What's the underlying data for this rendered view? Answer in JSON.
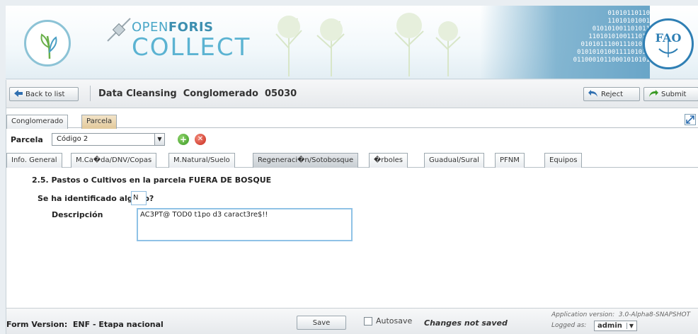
{
  "banner": {
    "brand_line1_a": "OPEN",
    "brand_line1_b": "FORIS",
    "brand_line2": "COLLECT",
    "binary_lines": [
      "01010110110",
      "11010101001",
      "010101001101011",
      "1101010100111010",
      "010101110011101011",
      "0101010100111101010",
      "01100010110001010101"
    ]
  },
  "toolbar": {
    "back_label": "Back to list",
    "title": "Data Cleansing  Conglomerado  05030",
    "reject_label": "Reject",
    "submit_label": "Submit"
  },
  "top_tabs": [
    {
      "label": "Conglomerado"
    },
    {
      "label": "Parcela"
    }
  ],
  "parcela": {
    "label": "Parcela",
    "selected": "Código 2"
  },
  "sub_tabs": [
    {
      "label": "Info. General"
    },
    {
      "label": "M.Ca�da/DNV/Copas"
    },
    {
      "label": "M.Natural/Suelo"
    },
    {
      "label": "Regeneraci�n/Sotobosque"
    },
    {
      "label": "�rboles"
    },
    {
      "label": "Guadual/Sural"
    },
    {
      "label": "PFNM"
    },
    {
      "label": "Equipos"
    }
  ],
  "form": {
    "section_title": "2.5.  Pastos o Cultivos en la parcela FUERA DE BOSQUE",
    "identified_label": "Se ha identificado alguno?",
    "identified_value": "N",
    "description_label": "Descripción",
    "description_value": "AC3PT@ TOD0 t1po d3 caract3re$!!"
  },
  "footer": {
    "form_version": "Form Version:  ENF - Etapa nacional",
    "save_label": "Save",
    "autosave_label": "Autosave",
    "status": "Changes not saved",
    "app_version": "Application version:  3.0-Alpha8-SNAPSHOT",
    "logged_as": "Logged as:",
    "user": "admin"
  }
}
